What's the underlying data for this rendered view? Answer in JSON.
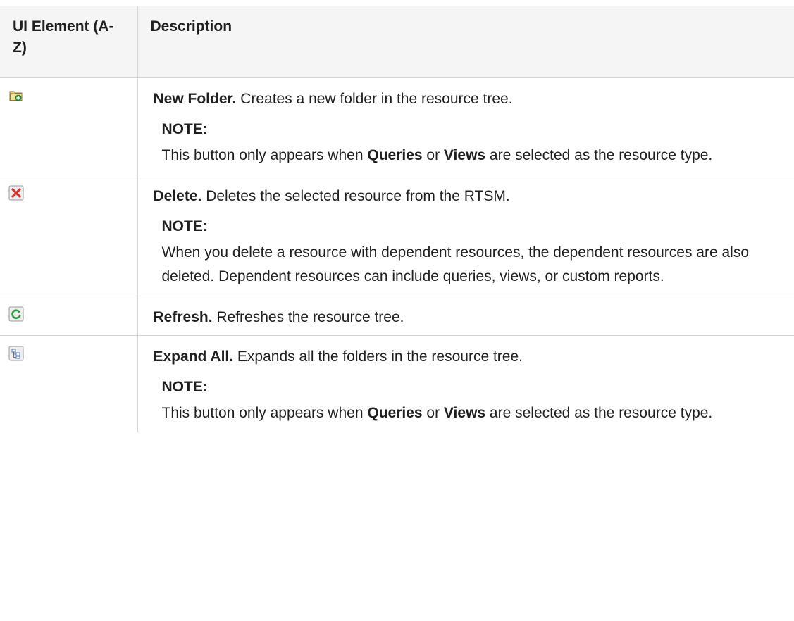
{
  "table": {
    "headers": {
      "ui_element": "UI Element (A-Z)",
      "description": "Description"
    },
    "rows": [
      {
        "icon": "new-folder-icon",
        "title": "New Folder.",
        "text": " Creates a new folder in the resource tree.",
        "note": {
          "heading": "NOTE:",
          "parts": [
            "This button only appears when ",
            "Queries",
            " or ",
            "Views",
            " are selected as the resource type."
          ]
        }
      },
      {
        "icon": "delete-icon",
        "title": "Delete.",
        "text": " Deletes the selected resource from the RTSM.",
        "note": {
          "heading": "NOTE:",
          "parts": [
            "When you delete a resource with dependent resources, the dependent resources are also deleted. Dependent resources can include queries, views, or custom reports."
          ]
        }
      },
      {
        "icon": "refresh-icon",
        "title": "Refresh.",
        "text": " Refreshes the resource tree."
      },
      {
        "icon": "expand-all-icon",
        "title": "Expand All.",
        "text": " Expands all the folders in the resource tree.",
        "note": {
          "heading": "NOTE:",
          "parts": [
            "This button only appears when ",
            "Queries",
            " or ",
            "Views",
            " are selected as the resource type."
          ]
        }
      }
    ]
  }
}
